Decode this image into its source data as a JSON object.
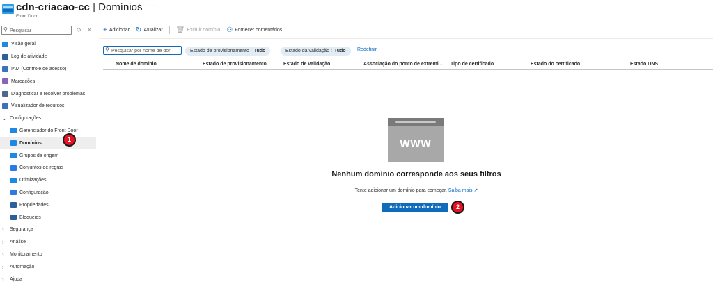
{
  "header": {
    "resource_name": "cdn-criacao-cc",
    "separator": "|",
    "page_title": "Domínios",
    "subtitle": "Front Door",
    "favorite_icon": "star-outline-icon",
    "more_label": "···"
  },
  "sidebar": {
    "search_placeholder": "Pesquisar",
    "controls": [
      "◇",
      "«"
    ],
    "items": [
      {
        "label": "Visão geral",
        "icon": "cloud-icon",
        "color": "#1e88e5",
        "indent": false,
        "active": false,
        "chevron": ""
      },
      {
        "label": "Log de atividade",
        "icon": "log-icon",
        "color": "#2c5f9e",
        "indent": false,
        "active": false,
        "chevron": ""
      },
      {
        "label": "IAM (Controle de acesso)",
        "icon": "people-icon",
        "color": "#3b73b9",
        "indent": false,
        "active": false,
        "chevron": ""
      },
      {
        "label": "Marcações",
        "icon": "tag-icon",
        "color": "#8764b8",
        "indent": false,
        "active": false,
        "chevron": ""
      },
      {
        "label": "Diagnosticar e resolver problemas",
        "icon": "wrench-icon",
        "color": "#4a6a8a",
        "indent": false,
        "active": false,
        "chevron": ""
      },
      {
        "label": "Visualizador de recursos",
        "icon": "hierarchy-icon",
        "color": "#3b73b9",
        "indent": false,
        "active": false,
        "chevron": ""
      },
      {
        "label": "Configurações",
        "icon": "",
        "color": "",
        "indent": false,
        "active": false,
        "chevron": "⌄"
      },
      {
        "label": "Gerenciador do Front Door",
        "icon": "frontdoor-manager-icon",
        "color": "#1e88e5",
        "indent": true,
        "active": false,
        "chevron": ""
      },
      {
        "label": "Domínios",
        "icon": "domains-icon",
        "color": "#1e88e5",
        "indent": true,
        "active": true,
        "chevron": ""
      },
      {
        "label": "Grupos de origem",
        "icon": "origin-groups-icon",
        "color": "#1e88e5",
        "indent": true,
        "active": false,
        "chevron": ""
      },
      {
        "label": "Conjuntos de regras",
        "icon": "rule-sets-icon",
        "color": "#2c7be5",
        "indent": true,
        "active": false,
        "chevron": ""
      },
      {
        "label": "Otimizações",
        "icon": "optimizations-icon",
        "color": "#1e88e5",
        "indent": true,
        "active": false,
        "chevron": ""
      },
      {
        "label": "Configuração",
        "icon": "configuration-icon",
        "color": "#2c7be5",
        "indent": true,
        "active": false,
        "chevron": ""
      },
      {
        "label": "Propriedades",
        "icon": "properties-icon",
        "color": "#2c5f9e",
        "indent": true,
        "active": false,
        "chevron": ""
      },
      {
        "label": "Bloqueios",
        "icon": "lock-icon",
        "color": "#2c5f9e",
        "indent": true,
        "active": false,
        "chevron": ""
      },
      {
        "label": "Segurança",
        "icon": "",
        "color": "",
        "indent": false,
        "active": false,
        "chevron": "›"
      },
      {
        "label": "Análise",
        "icon": "",
        "color": "",
        "indent": false,
        "active": false,
        "chevron": "›"
      },
      {
        "label": "Monitoramento",
        "icon": "",
        "color": "",
        "indent": false,
        "active": false,
        "chevron": "›"
      },
      {
        "label": "Automação",
        "icon": "",
        "color": "",
        "indent": false,
        "active": false,
        "chevron": "›"
      },
      {
        "label": "Ajuda",
        "icon": "",
        "color": "",
        "indent": false,
        "active": false,
        "chevron": "›"
      }
    ]
  },
  "toolbar": {
    "add_label": "Adicionar",
    "refresh_label": "Atualizar",
    "delete_label": "Excluir domínio",
    "feedback_label": "Fornecer comentários"
  },
  "filters": {
    "search_placeholder": "Pesquisar por nome de dor",
    "provisioning_label": "Estado de provisionamento :",
    "provisioning_value": "Tudo",
    "validation_label": "Estado da validação :",
    "validation_value": "Tudo",
    "reset_label": "Redefinir"
  },
  "table": {
    "columns": [
      "Nome de domínio",
      "Estado de provisionamento",
      "Estado de validação",
      "Associação do ponto de extremi...",
      "Tipo de certificado",
      "Estado do certificado",
      "Estado DNS"
    ],
    "rows": []
  },
  "empty_state": {
    "graphic_text": "www",
    "title": "Nenhum domínio corresponde aos seus filtros",
    "text": "Tente adicionar um domínio para começar.",
    "learn_more": "Saiba mais",
    "external_icon": "↗",
    "button_label": "Adicionar um domínio"
  },
  "badges": [
    "1",
    "2"
  ],
  "colors": {
    "accent": "#0f6cbd",
    "badge": "#e81123",
    "pill": "#e1ecf5",
    "active_row": "#eeeeee"
  }
}
